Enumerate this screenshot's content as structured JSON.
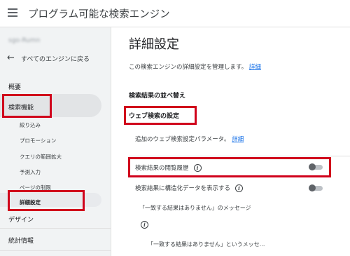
{
  "app": {
    "title": "プログラム可能な検索エンジン"
  },
  "sidebar": {
    "account": "sgo-Rumn",
    "back_label": "すべてのエンジンに戻る",
    "overview": "概要",
    "search_features": "検索機能",
    "sub_items": [
      "絞り込み",
      "プロモーション",
      "クエリの範囲拡大",
      "予測入力",
      "ページの制限",
      "詳細設定"
    ],
    "design": "デザイン",
    "statistics": "統計情報"
  },
  "main": {
    "title": "詳細設定",
    "description": "この検索エンジンの詳細設定を管理します。",
    "description_link": "詳細",
    "sort_heading": "検索結果の並べ替え",
    "web_heading": "ウェブ検索の設定",
    "extra_params": "追加のウェブ検索設定パラメータ。",
    "extra_params_link": "詳細",
    "browse_history": "検索結果の閲覧履歴",
    "structured_data": "検索結果に構造化データを表示する",
    "no_match_heading": "「一致する結果はありません」のメッセージ",
    "no_match_value": "「一致する結果はありません」というメッセ..."
  },
  "colors": {
    "highlight": "#d0021b",
    "link": "#1a73e8"
  }
}
